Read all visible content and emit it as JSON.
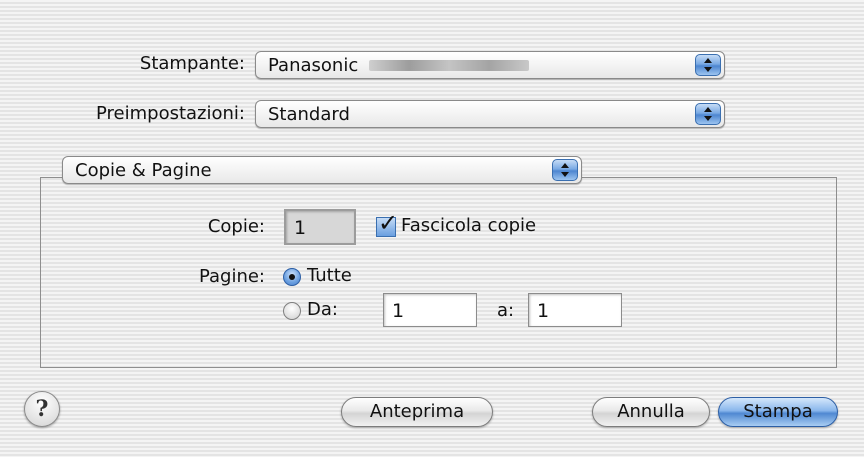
{
  "printer": {
    "label": "Stampante:",
    "value": "Panasonic"
  },
  "presets": {
    "label": "Preimpostazioni:",
    "value": "Standard"
  },
  "section": {
    "value": "Copie & Pagine"
  },
  "copies": {
    "label": "Copie:",
    "value": "1",
    "collate_label": "Fascicola copie",
    "collate_checked": true
  },
  "pages": {
    "label": "Pagine:",
    "all_label": "Tutte",
    "from_label": "Da:",
    "from_value": "1",
    "to_label": "a:",
    "to_value": "1",
    "selected": "all"
  },
  "buttons": {
    "help": "?",
    "preview": "Anteprima",
    "cancel": "Annulla",
    "print": "Stampa"
  },
  "icons": {
    "popup_arrows": "up-down-arrows-icon",
    "checkmark": "checkmark-icon",
    "help": "help-icon"
  },
  "colors": {
    "accent": "#5a8fd6",
    "background": "#ececec"
  }
}
